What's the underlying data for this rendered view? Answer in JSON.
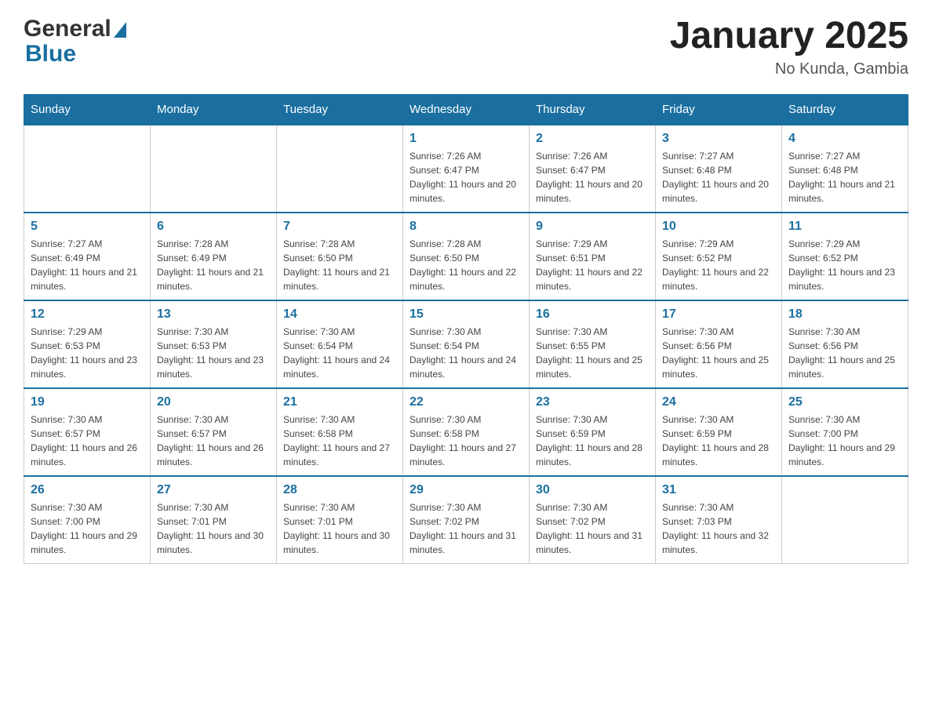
{
  "header": {
    "logo_general": "General",
    "logo_blue": "Blue",
    "title": "January 2025",
    "location": "No Kunda, Gambia"
  },
  "days_of_week": [
    "Sunday",
    "Monday",
    "Tuesday",
    "Wednesday",
    "Thursday",
    "Friday",
    "Saturday"
  ],
  "weeks": [
    [
      {
        "day": "",
        "info": ""
      },
      {
        "day": "",
        "info": ""
      },
      {
        "day": "",
        "info": ""
      },
      {
        "day": "1",
        "info": "Sunrise: 7:26 AM\nSunset: 6:47 PM\nDaylight: 11 hours and 20 minutes."
      },
      {
        "day": "2",
        "info": "Sunrise: 7:26 AM\nSunset: 6:47 PM\nDaylight: 11 hours and 20 minutes."
      },
      {
        "day": "3",
        "info": "Sunrise: 7:27 AM\nSunset: 6:48 PM\nDaylight: 11 hours and 20 minutes."
      },
      {
        "day": "4",
        "info": "Sunrise: 7:27 AM\nSunset: 6:48 PM\nDaylight: 11 hours and 21 minutes."
      }
    ],
    [
      {
        "day": "5",
        "info": "Sunrise: 7:27 AM\nSunset: 6:49 PM\nDaylight: 11 hours and 21 minutes."
      },
      {
        "day": "6",
        "info": "Sunrise: 7:28 AM\nSunset: 6:49 PM\nDaylight: 11 hours and 21 minutes."
      },
      {
        "day": "7",
        "info": "Sunrise: 7:28 AM\nSunset: 6:50 PM\nDaylight: 11 hours and 21 minutes."
      },
      {
        "day": "8",
        "info": "Sunrise: 7:28 AM\nSunset: 6:50 PM\nDaylight: 11 hours and 22 minutes."
      },
      {
        "day": "9",
        "info": "Sunrise: 7:29 AM\nSunset: 6:51 PM\nDaylight: 11 hours and 22 minutes."
      },
      {
        "day": "10",
        "info": "Sunrise: 7:29 AM\nSunset: 6:52 PM\nDaylight: 11 hours and 22 minutes."
      },
      {
        "day": "11",
        "info": "Sunrise: 7:29 AM\nSunset: 6:52 PM\nDaylight: 11 hours and 23 minutes."
      }
    ],
    [
      {
        "day": "12",
        "info": "Sunrise: 7:29 AM\nSunset: 6:53 PM\nDaylight: 11 hours and 23 minutes."
      },
      {
        "day": "13",
        "info": "Sunrise: 7:30 AM\nSunset: 6:53 PM\nDaylight: 11 hours and 23 minutes."
      },
      {
        "day": "14",
        "info": "Sunrise: 7:30 AM\nSunset: 6:54 PM\nDaylight: 11 hours and 24 minutes."
      },
      {
        "day": "15",
        "info": "Sunrise: 7:30 AM\nSunset: 6:54 PM\nDaylight: 11 hours and 24 minutes."
      },
      {
        "day": "16",
        "info": "Sunrise: 7:30 AM\nSunset: 6:55 PM\nDaylight: 11 hours and 25 minutes."
      },
      {
        "day": "17",
        "info": "Sunrise: 7:30 AM\nSunset: 6:56 PM\nDaylight: 11 hours and 25 minutes."
      },
      {
        "day": "18",
        "info": "Sunrise: 7:30 AM\nSunset: 6:56 PM\nDaylight: 11 hours and 25 minutes."
      }
    ],
    [
      {
        "day": "19",
        "info": "Sunrise: 7:30 AM\nSunset: 6:57 PM\nDaylight: 11 hours and 26 minutes."
      },
      {
        "day": "20",
        "info": "Sunrise: 7:30 AM\nSunset: 6:57 PM\nDaylight: 11 hours and 26 minutes."
      },
      {
        "day": "21",
        "info": "Sunrise: 7:30 AM\nSunset: 6:58 PM\nDaylight: 11 hours and 27 minutes."
      },
      {
        "day": "22",
        "info": "Sunrise: 7:30 AM\nSunset: 6:58 PM\nDaylight: 11 hours and 27 minutes."
      },
      {
        "day": "23",
        "info": "Sunrise: 7:30 AM\nSunset: 6:59 PM\nDaylight: 11 hours and 28 minutes."
      },
      {
        "day": "24",
        "info": "Sunrise: 7:30 AM\nSunset: 6:59 PM\nDaylight: 11 hours and 28 minutes."
      },
      {
        "day": "25",
        "info": "Sunrise: 7:30 AM\nSunset: 7:00 PM\nDaylight: 11 hours and 29 minutes."
      }
    ],
    [
      {
        "day": "26",
        "info": "Sunrise: 7:30 AM\nSunset: 7:00 PM\nDaylight: 11 hours and 29 minutes."
      },
      {
        "day": "27",
        "info": "Sunrise: 7:30 AM\nSunset: 7:01 PM\nDaylight: 11 hours and 30 minutes."
      },
      {
        "day": "28",
        "info": "Sunrise: 7:30 AM\nSunset: 7:01 PM\nDaylight: 11 hours and 30 minutes."
      },
      {
        "day": "29",
        "info": "Sunrise: 7:30 AM\nSunset: 7:02 PM\nDaylight: 11 hours and 31 minutes."
      },
      {
        "day": "30",
        "info": "Sunrise: 7:30 AM\nSunset: 7:02 PM\nDaylight: 11 hours and 31 minutes."
      },
      {
        "day": "31",
        "info": "Sunrise: 7:30 AM\nSunset: 7:03 PM\nDaylight: 11 hours and 32 minutes."
      },
      {
        "day": "",
        "info": ""
      }
    ]
  ]
}
